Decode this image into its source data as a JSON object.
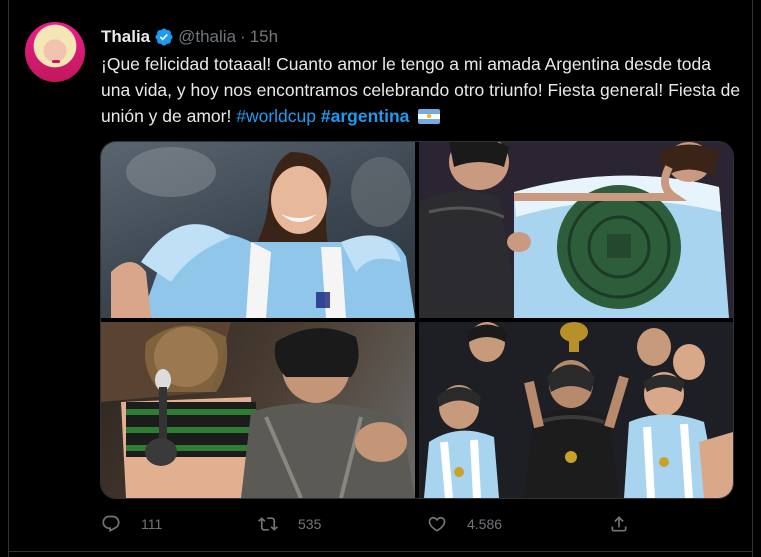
{
  "tweet": {
    "name": "Thalia",
    "handle": "@thalia",
    "separator": "·",
    "time": "15h",
    "text_plain": "¡Que felicidad totaaal! Cuanto amor le tengo a mi amada Argentina desde toda una vida, y hoy nos encontramos celebrando otro triunfo! Fiesta general! Fiesta de unión y de amor!",
    "hashtag1": "#worldcup",
    "hashtag2": "#argentina",
    "flag_emoji_name": "argentina-flag-icon"
  },
  "actions": {
    "replies": "111",
    "retweets": "535",
    "likes": "4.586"
  },
  "colors": {
    "background": "#000000",
    "text": "#e7e9ea",
    "muted": "#71767b",
    "link": "#1d9bf0",
    "border": "#2f3336",
    "verified": "#1d9bf0"
  }
}
